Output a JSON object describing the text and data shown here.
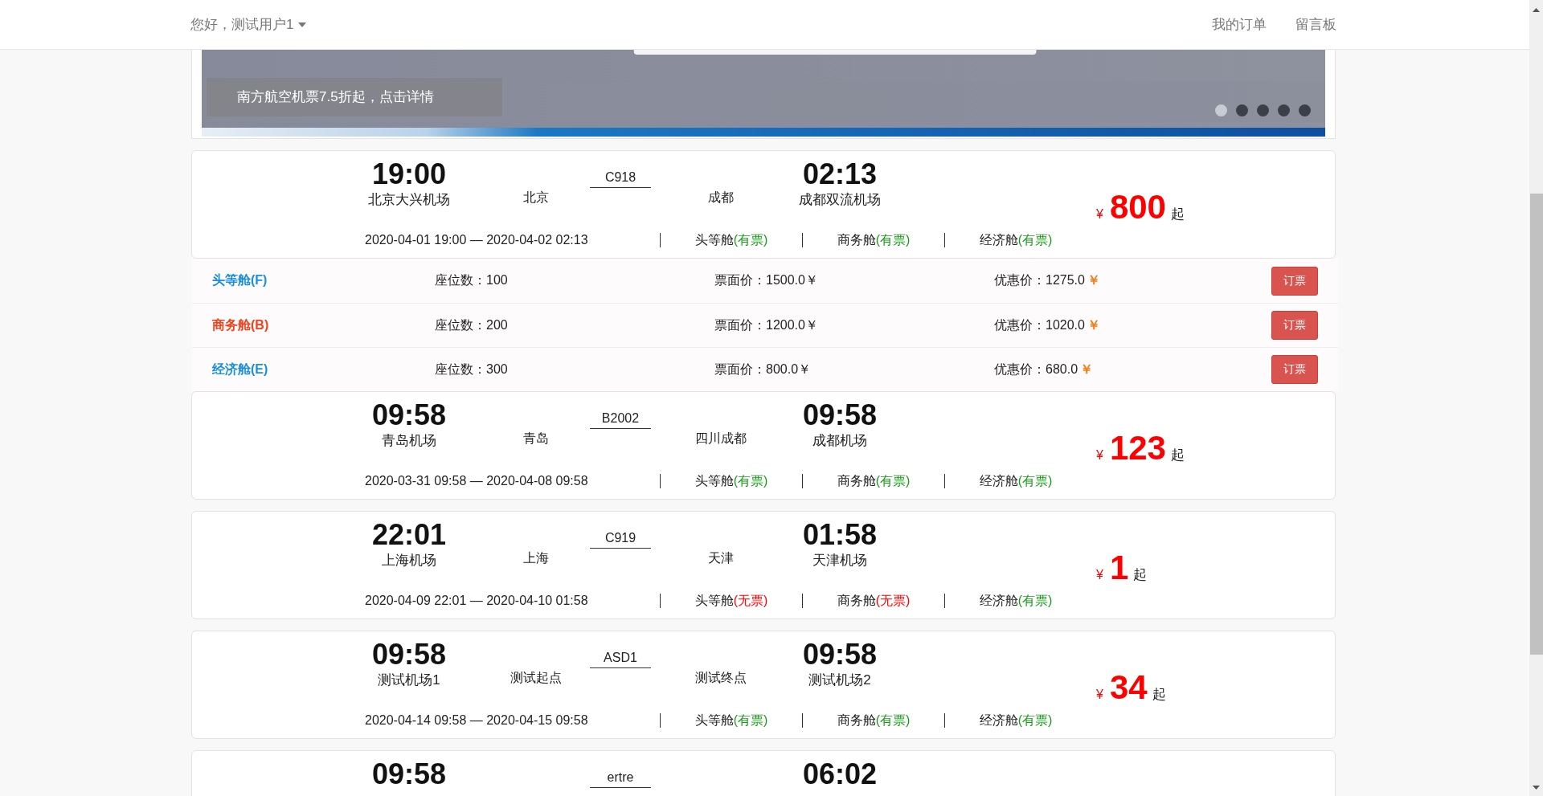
{
  "navbar": {
    "greeting": "您好，测试用户1",
    "links": [
      "我的订单",
      "留言板"
    ]
  },
  "banner": {
    "caption": "南方航空机票7.5折起，点击详情",
    "slides": [
      {
        "selected": true
      },
      {
        "selected": false
      },
      {
        "selected": false
      },
      {
        "selected": false
      },
      {
        "selected": false
      }
    ]
  },
  "flights": [
    {
      "depart_time": "19:00",
      "depart_airport": "北京大兴机场",
      "depart_city": "北京",
      "flight_no": "C918",
      "arrive_city": "成都",
      "arrive_time": "02:13",
      "arrive_airport": "成都双流机场",
      "currency": "¥",
      "price": "800",
      "price_suffix": "起",
      "schedule": "2020-04-01 19:00 — 2020-04-02 02:13",
      "cabins": [
        {
          "label": "头等舱",
          "status": "(有票)",
          "available": true
        },
        {
          "label": "商务舱",
          "status": "(有票)",
          "available": true
        },
        {
          "label": "经济舱",
          "status": "(有票)",
          "available": true
        }
      ],
      "cabin_details": [
        {
          "name": "头等舱(F)",
          "color": "#1a8fdc",
          "seats": "座位数：100",
          "face_price": "票面价：1500.0￥",
          "discount_price": "优惠价：1275.0",
          "discount_currency": "￥",
          "button": "订票"
        },
        {
          "name": "商务舱(B)",
          "color": "#f5401b",
          "seats": "座位数：200",
          "face_price": "票面价：1200.0￥",
          "discount_price": "优惠价：1020.0",
          "discount_currency": "￥",
          "button": "订票"
        },
        {
          "name": "经济舱(E)",
          "color": "#1a8fdc",
          "seats": "座位数：300",
          "face_price": "票面价：800.0￥",
          "discount_price": "优惠价：680.0",
          "discount_currency": "￥",
          "button": "订票"
        }
      ]
    },
    {
      "depart_time": "09:58",
      "depart_airport": "青岛机场",
      "depart_city": "青岛",
      "flight_no": "B2002",
      "arrive_city": "四川成都",
      "arrive_time": "09:58",
      "arrive_airport": "成都机场",
      "currency": "¥",
      "price": "123",
      "price_suffix": "起",
      "schedule": "2020-03-31 09:58 — 2020-04-08 09:58",
      "cabins": [
        {
          "label": "头等舱",
          "status": "(有票)",
          "available": true
        },
        {
          "label": "商务舱",
          "status": "(有票)",
          "available": true
        },
        {
          "label": "经济舱",
          "status": "(有票)",
          "available": true
        }
      ]
    },
    {
      "depart_time": "22:01",
      "depart_airport": "上海机场",
      "depart_city": "上海",
      "flight_no": "C919",
      "arrive_city": "天津",
      "arrive_time": "01:58",
      "arrive_airport": "天津机场",
      "currency": "¥",
      "price": "1",
      "price_suffix": "起",
      "schedule": "2020-04-09 22:01 — 2020-04-10 01:58",
      "cabins": [
        {
          "label": "头等舱",
          "status": "(无票)",
          "available": false
        },
        {
          "label": "商务舱",
          "status": "(无票)",
          "available": false
        },
        {
          "label": "经济舱",
          "status": "(有票)",
          "available": true
        }
      ]
    },
    {
      "depart_time": "09:58",
      "depart_airport": "测试机场1",
      "depart_city": "测试起点",
      "flight_no": "ASD1",
      "arrive_city": "测试终点",
      "arrive_time": "09:58",
      "arrive_airport": "测试机场2",
      "currency": "¥",
      "price": "34",
      "price_suffix": "起",
      "schedule": "2020-04-14 09:58 — 2020-04-15 09:58",
      "cabins": [
        {
          "label": "头等舱",
          "status": "(有票)",
          "available": true
        },
        {
          "label": "商务舱",
          "status": "(有票)",
          "available": true
        },
        {
          "label": "经济舱",
          "status": "(有票)",
          "available": true
        }
      ]
    },
    {
      "depart_time": "09:58",
      "flight_no": "ertre",
      "arrive_time": "06:02"
    }
  ]
}
